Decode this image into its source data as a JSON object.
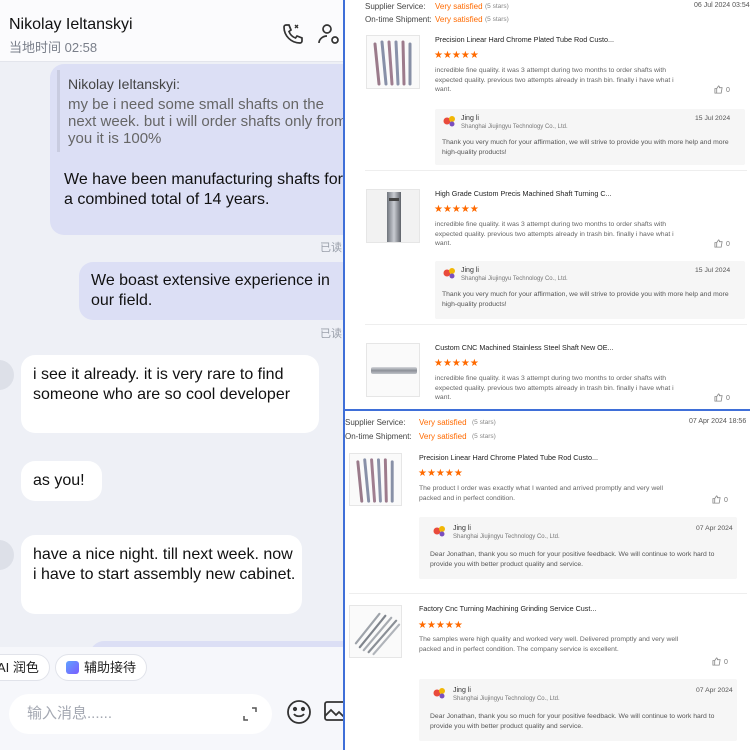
{
  "chat": {
    "contact_name": "Nikolay Ieltanskyi",
    "local_time": "当地时间 02:58",
    "header_icons": [
      "phone-icon",
      "contact-profile-icon"
    ],
    "messages": [
      {
        "direction": "out",
        "quote_name": "Nikolay Ieltanskyi:",
        "quote_text": "my be i need some small shafts on the next week. but i will order shafts only from you it is 100%",
        "text": "We have been manufacturing shafts for a combined total of 14 years.",
        "status": "已读"
      },
      {
        "direction": "out",
        "text": "We boast extensive experience in our field.",
        "status": "已读"
      },
      {
        "direction": "in",
        "text": "i see it already. it is very rare to find someone who are so cool developer"
      },
      {
        "direction": "in",
        "text": "as you!"
      },
      {
        "direction": "in",
        "text": "have a nice night. till next week. now i have to start assembly new cabinet."
      }
    ],
    "tools": [
      {
        "label": "AI 润色"
      },
      {
        "label": "辅助接待"
      }
    ],
    "input_placeholder": "输入消息......",
    "icons": {
      "expand": "expand-icon",
      "emoji": "emoji-icon",
      "image": "image-icon"
    }
  },
  "panel_top": {
    "supplier_service_label": "Supplier Service:",
    "supplier_service_value": "Very satisfied",
    "supplier_service_note": "(5 stars)",
    "ontime_label": "On-time Shipment:",
    "ontime_value": "Very satisfied",
    "ontime_note": "(5 stars)",
    "date": "06 Jul 2024 03:54",
    "reviews": [
      {
        "title": "Precision Linear Hard Chrome Plated Tube Rod Custo...",
        "stars": "★★★★★",
        "text": "incredible fine quality. it was 3 attempt during two months to order shafts with expected quality. previous two attempts already in trash bin. finally i have what i want.",
        "likes": "0",
        "reply": {
          "name": "Jing li",
          "company": "Shanghai Jiujingyu Technology Co., Ltd.",
          "date": "15 Jul 2024",
          "text": "Thank you very much for your affirmation, we will strive to provide you with more help and more high-quality products!"
        }
      },
      {
        "title": "High Grade Custom Precis Machined Shaft Turning C...",
        "stars": "★★★★★",
        "text": "incredible fine quality. it was 3 attempt during two months to order shafts with expected quality. previous two attempts already in trash bin. finally i have what i want.",
        "likes": "0",
        "reply": {
          "name": "Jing li",
          "company": "Shanghai Jiujingyu Technology Co., Ltd.",
          "date": "15 Jul 2024",
          "text": "Thank you very much for your affirmation, we will strive to provide you with more help and more high-quality products!"
        }
      },
      {
        "title": "Custom CNC Machined Stainless Steel Shaft New OE...",
        "stars": "★★★★★",
        "text": "incredible fine quality. it was 3 attempt during two months to order shafts with expected quality. previous two attempts already in trash bin. finally i have what i want.",
        "likes": "0"
      }
    ]
  },
  "panel_bottom": {
    "supplier_service_label": "Supplier Service:",
    "supplier_service_value": "Very satisfied",
    "supplier_service_note": "(5 stars)",
    "ontime_label": "On-time Shipment:",
    "ontime_value": "Very satisfied",
    "ontime_note": "(5 stars)",
    "date": "07 Apr 2024 18:56",
    "reviews": [
      {
        "title": "Precision Linear Hard Chrome Plated Tube Rod Custo...",
        "stars": "★★★★★",
        "text": "The product I order was exactly what I wanted and arrived promptly and very well packed and in perfect condition.",
        "likes": "0",
        "reply": {
          "name": "Jing li",
          "company": "Shanghai Jiujingyu Technology Co., Ltd.",
          "date": "07 Apr 2024",
          "text": "Dear Jonathan, thank you so much for your positive feedback. We will continue to work hard to provide you with better product quality and service."
        }
      },
      {
        "title": "Factory Cnc Turning Machining Grinding Service Cust...",
        "stars": "★★★★★",
        "text": "The samples were high quality and worked very well. Delivered promptly and very well packed and in perfect condition. The company service is excellent.",
        "likes": "0",
        "reply": {
          "name": "Jing li",
          "company": "Shanghai Jiujingyu Technology Co., Ltd.",
          "date": "07 Apr 2024",
          "text": "Dear Jonathan, thank you so much for your positive feedback. We will continue to work hard to provide you with better product quality and service."
        }
      }
    ]
  },
  "colors": {
    "accent_orange": "#ff6a00",
    "outgoing_bubble": "#dcdff5",
    "chat_background": "#eef0f6",
    "divider_blue": "#3f6fd8"
  }
}
